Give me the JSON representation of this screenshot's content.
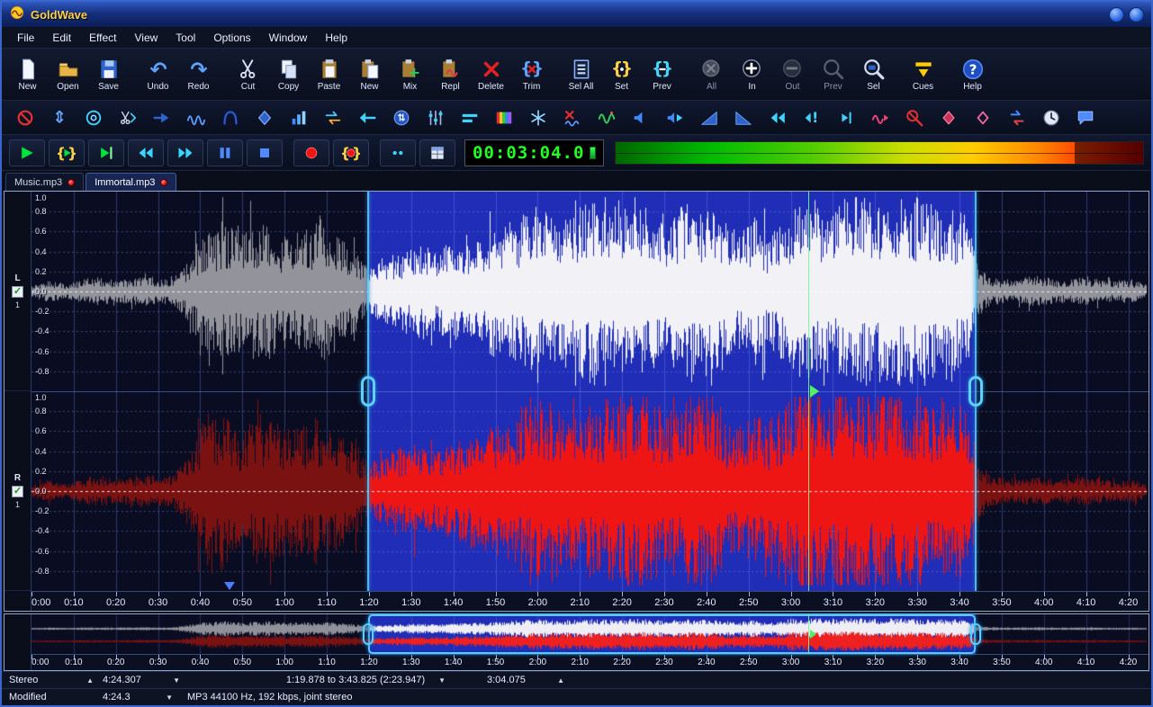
{
  "window": {
    "title": "GoldWave",
    "controls": [
      {
        "name": "minimize-button"
      },
      {
        "name": "close-button"
      }
    ]
  },
  "menu": {
    "items": [
      "File",
      "Edit",
      "Effect",
      "View",
      "Tool",
      "Options",
      "Window",
      "Help"
    ]
  },
  "toolbar_main": {
    "buttons": [
      {
        "name": "new",
        "label": "New"
      },
      {
        "name": "open",
        "label": "Open"
      },
      {
        "name": "save",
        "label": "Save"
      },
      {
        "name": "undo",
        "label": "Undo"
      },
      {
        "name": "redo",
        "label": "Redo"
      },
      {
        "name": "cut",
        "label": "Cut"
      },
      {
        "name": "copy",
        "label": "Copy"
      },
      {
        "name": "paste",
        "label": "Paste"
      },
      {
        "name": "paste-new",
        "label": "New"
      },
      {
        "name": "mix",
        "label": "Mix"
      },
      {
        "name": "replace",
        "label": "Repl"
      },
      {
        "name": "delete",
        "label": "Delete"
      },
      {
        "name": "trim",
        "label": "Trim"
      },
      {
        "name": "select-all",
        "label": "Sel All"
      },
      {
        "name": "set-marker",
        "label": "Set"
      },
      {
        "name": "prev-marker",
        "label": "Prev"
      },
      {
        "name": "zoom-all",
        "label": "All",
        "disabled": true
      },
      {
        "name": "zoom-in",
        "label": "In"
      },
      {
        "name": "zoom-out",
        "label": "Out",
        "disabled": true
      },
      {
        "name": "zoom-prev",
        "label": "Prev",
        "disabled": true
      },
      {
        "name": "zoom-sel",
        "label": "Sel"
      },
      {
        "name": "cues",
        "label": "Cues"
      },
      {
        "name": "help",
        "label": "Help"
      }
    ]
  },
  "toolbar_effects": {
    "icons": [
      "effect-disable",
      "adjust-volume",
      "match-volume",
      "smart-edit",
      "goto-marker",
      "doppler",
      "invert",
      "flanger",
      "mixer",
      "swap-channels",
      "back-shift",
      "playback-device",
      "equalizer",
      "bands",
      "spectrum-filter",
      "noise-reduction",
      "silence-removal",
      "spectrum-analyzer",
      "speaker",
      "monitor-speaker",
      "fade-in",
      "fade-out",
      "shift-left",
      "seek-warning",
      "step-forward",
      "pitch-shift",
      "noise-gate",
      "reverb",
      "echo",
      "channel-mixer",
      "timer",
      "comments"
    ]
  },
  "transport": {
    "buttons": [
      "play",
      "play-selection",
      "play-from",
      "rewind",
      "fast-forward",
      "pause",
      "stop",
      "record",
      "record-selection",
      "monitor",
      "control-window"
    ],
    "time": "00:03:04.0"
  },
  "tabs": [
    {
      "label": "Music.mp3",
      "active": false,
      "modified": true
    },
    {
      "label": "Immortal.mp3",
      "active": true,
      "modified": true
    }
  ],
  "editor": {
    "channels": [
      {
        "label": "L",
        "number": "1",
        "enabled": true
      },
      {
        "label": "R",
        "number": "1",
        "enabled": true
      }
    ],
    "amplitude_labels": [
      "1.0",
      "0.8",
      "0.6",
      "0.4",
      "0.2",
      "0.0",
      "-0.2",
      "-0.4",
      "-0.6",
      "-0.8"
    ],
    "time_labels": [
      "0:00",
      "0:10",
      "0:20",
      "0:30",
      "0:40",
      "0:50",
      "1:00",
      "1:10",
      "1:20",
      "1:30",
      "1:40",
      "1:50",
      "2:00",
      "2:10",
      "2:20",
      "2:30",
      "2:40",
      "2:50",
      "3:00",
      "3:10",
      "3:20",
      "3:30",
      "3:40",
      "3:50",
      "4:00",
      "4:10",
      "4:20"
    ],
    "duration_seconds": 264.307,
    "selection_start_seconds": 79.878,
    "selection_end_seconds": 223.825,
    "playhead_seconds": 184.075,
    "cue_marker_seconds": 47
  },
  "overview": {
    "time_labels": [
      "0:00",
      "0:10",
      "0:20",
      "0:30",
      "0:40",
      "0:50",
      "1:00",
      "1:10",
      "1:20",
      "1:30",
      "1:40",
      "1:50",
      "2:00",
      "2:10",
      "2:20",
      "2:30",
      "2:40",
      "2:50",
      "3:00",
      "3:10",
      "3:20",
      "3:30",
      "3:40",
      "3:50",
      "4:00",
      "4:10",
      "4:20"
    ]
  },
  "status_upper": {
    "fields": [
      {
        "name": "channel-mode",
        "text": "Stereo",
        "arrow": "up"
      },
      {
        "name": "total-length",
        "text": "4:24.307",
        "arrow": "down"
      },
      {
        "name": "selection-range",
        "text": "1:19.878 to 3:43.825 (2:23.947)",
        "arrow": "down"
      },
      {
        "name": "playback-position",
        "text": "3:04.075",
        "arrow": "up"
      }
    ]
  },
  "status_lower": {
    "fields": [
      {
        "name": "modified-state",
        "text": "Modified"
      },
      {
        "name": "display-length",
        "text": "4:24.3",
        "arrow": "down"
      },
      {
        "name": "file-format",
        "text": "MP3 44100 Hz, 192 kbps, joint stereo"
      }
    ]
  },
  "colors": {
    "selection_background": "#202db6",
    "unselected_background": "#0a0d22",
    "left_waveform_selected": "#f2f2f6",
    "left_waveform_unselected": "#93939b",
    "right_waveform_selected": "#ee1515",
    "right_waveform_unselected": "#7a1212",
    "playhead": "#55ee66",
    "selection_marker": "#5fd0ff",
    "time_display_text": "#22ff22",
    "title_text": "#ffd24a"
  }
}
